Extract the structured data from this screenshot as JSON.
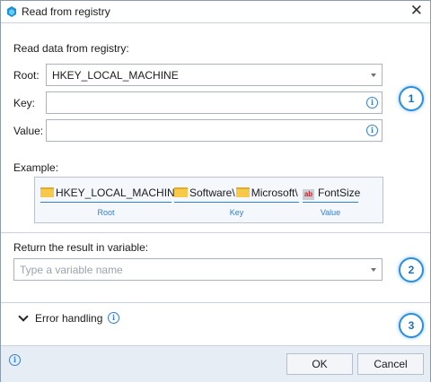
{
  "window": {
    "title": "Read from registry",
    "close_glyph": "✕"
  },
  "form": {
    "heading": "Read data from registry:",
    "root_label": "Root:",
    "root_value": "HKEY_LOCAL_MACHINE",
    "key_label": "Key:",
    "key_value": "",
    "value_label": "Value:",
    "value_value": ""
  },
  "example": {
    "label": "Example:",
    "root_text": "HKEY_LOCAL_MACHINE\\",
    "key_part1": "Software\\",
    "key_part2": "Microsoft\\",
    "value_icon": "ab",
    "value_text": "FontSize",
    "caption_root": "Root",
    "caption_key": "Key",
    "caption_value": "Value"
  },
  "result": {
    "label": "Return the result in variable:",
    "placeholder": "Type a variable name"
  },
  "error": {
    "label": "Error handling"
  },
  "badges": [
    "1",
    "2",
    "3"
  ],
  "footer": {
    "ok_label": "OK",
    "cancel_label": "Cancel"
  },
  "icons": {
    "info": "i",
    "accent": "#2f7fd8",
    "folder": "#f7c94b"
  }
}
